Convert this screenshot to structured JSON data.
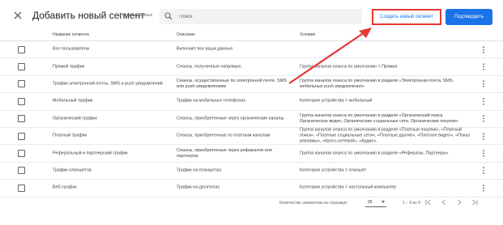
{
  "header": {
    "title": "Добавить новый сегмент",
    "subtitle": "1 из 9 выбранных",
    "search_placeholder": "Поиск",
    "create_button": "Создать новый сегмент",
    "confirm_button": "Подтвердить"
  },
  "table": {
    "columns": [
      "Название сегмента",
      "Описание",
      "Условие"
    ],
    "rows": [
      {
        "name": "Все пользователи",
        "desc": "Включает все ваши данные.",
        "cond": ""
      },
      {
        "name": "Прямой трафик",
        "desc": "Сеансы, полученные напрямую.",
        "cond": "Группа каналов сеанса по умолчанию = Прямая"
      },
      {
        "name": "Трафик электронной почты, SMS и push уведомлений",
        "desc": "Сеансы, осуществленные по электронной почте, SMS или push-уведомлениям",
        "cond": "Группа каналов сеанса по умолчанию в разделе «Электронная почта, SMS, мобильные push-уведомления»"
      },
      {
        "name": "Мобильный трафик",
        "desc": "Трафик на мобильных телефонах.",
        "cond": "Категория устройства = мобильный"
      },
      {
        "name": "Органический трафик",
        "desc": "Сеансы, приобретенные через органические каналы.",
        "cond": "Группа каналов сеанса по умолчанию в разделе «Органический поиск, Органическое видео, Органические социальные сети, Органические покупки»"
      },
      {
        "name": "Платный трафик",
        "desc": "Сеансы, приобретенные по платным каналам",
        "cond": "Группа каналов сеанса по умолчанию в разделе «Платные покупки», «Платный поиск», «Платные социальные сети», «Платные другие», «Платное видео», «Показ рекламы», «Кросс-сетевой», «Аудио»."
      },
      {
        "name": "Реферальный и партнерский трафик",
        "desc": "Сеансы, приобретенные через рефералов или партнеров.",
        "cond": "Группа каналов сеанса по умолчанию в разделе «Рефералы, Партнеры»"
      },
      {
        "name": "Трафик планшетов",
        "desc": "Трафик на планшетах.",
        "cond": "Категория устройства = планшет"
      },
      {
        "name": "Веб-трафик",
        "desc": "Трафик на десктопах",
        "cond": "Категория устройства = настольный компьютер"
      }
    ]
  },
  "footer": {
    "rows_per_page_label": "Количество элементов на странице:",
    "rows_per_page_value": "25",
    "range": "1 – 9 из 9"
  },
  "colors": {
    "accent": "#1a73e8",
    "highlight": "#e53935"
  }
}
